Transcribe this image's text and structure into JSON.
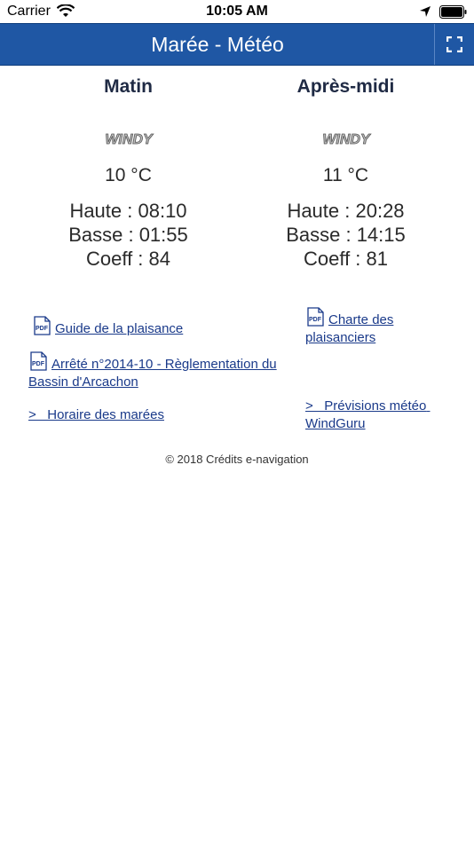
{
  "status_bar": {
    "carrier": "Carrier",
    "time": "10:05 AM",
    "icons": [
      "wifi-icon",
      "location-arrow-icon",
      "battery-icon"
    ]
  },
  "nav": {
    "title": "Marée - Météo",
    "fullscreen_icon": "fullscreen-icon"
  },
  "morning": {
    "title": "Matin",
    "logo_text": "WINDY",
    "temperature": "10 °C",
    "high": "Haute : 08:10",
    "low": "Basse : 01:55",
    "coeff": "Coeff : 84"
  },
  "afternoon": {
    "title": "Après-midi",
    "logo_text": "WINDY",
    "temperature": "11 °C",
    "high": "Haute : 20:28",
    "low": "Basse : 14:15",
    "coeff": "Coeff : 81"
  },
  "links": {
    "guide": "Guide de la plaisance",
    "arrete": "Arrêté n°2014-10 - Règlementation du Bassin d'Arcachon",
    "horaire": ">   Horaire des marées",
    "charte": "Charte des plaisanciers",
    "previsions": ">   Prévisions météo WindGuru"
  },
  "footer": {
    "credits": "© 2018 Crédits e-navigation"
  },
  "colors": {
    "nav_bg": "#1f57a4",
    "link": "#1a3a8a"
  }
}
